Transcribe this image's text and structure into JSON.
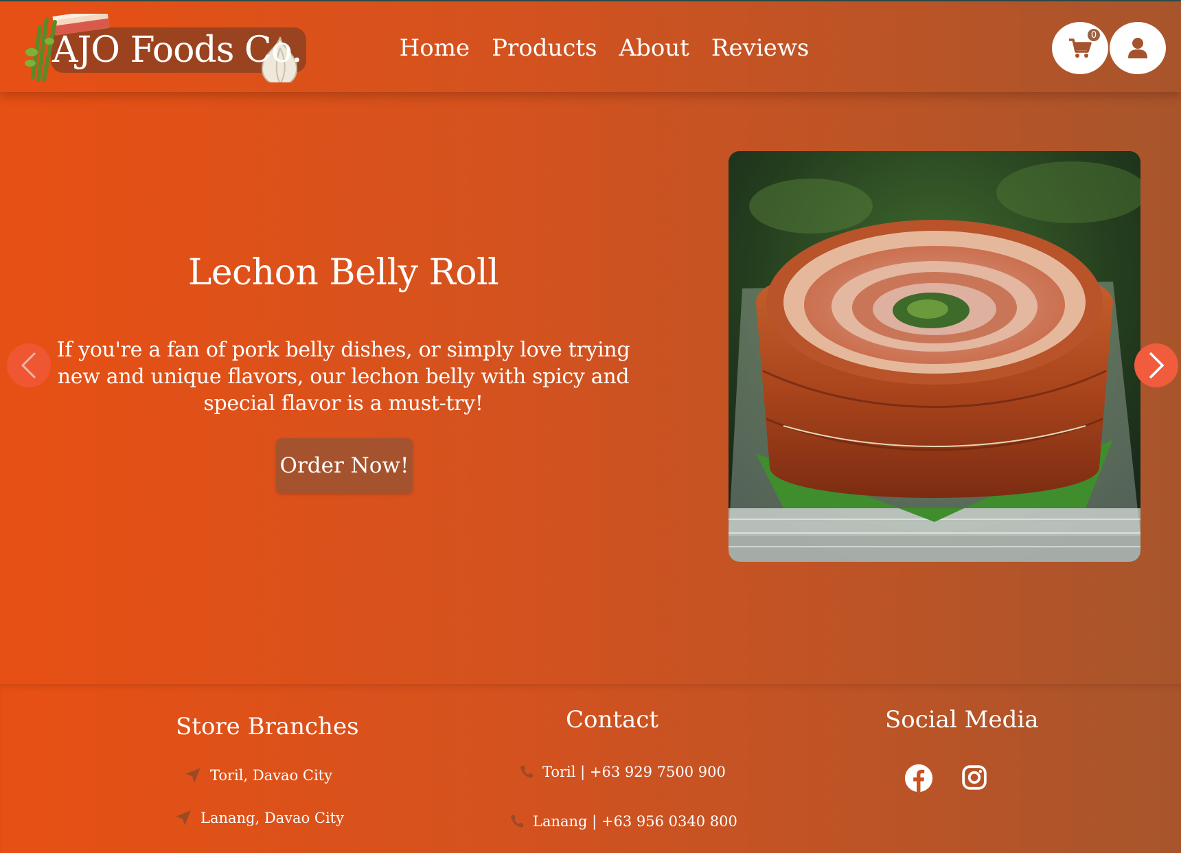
{
  "brand": {
    "name": "AJO Foods Co."
  },
  "nav": {
    "links": [
      "Home",
      "Products",
      "About",
      "Reviews"
    ]
  },
  "header": {
    "cart_count": "0"
  },
  "hero": {
    "title": "Lechon Belly Roll",
    "description": "If you're a fan of pork belly dishes, or simply love trying new and unique flavors, our lechon belly with spicy and special flavor is a must-try!",
    "cta_label": "Order Now!"
  },
  "footer": {
    "branches": {
      "title": "Store Branches",
      "items": [
        "Toril, Davao City",
        "Lanang, Davao City"
      ]
    },
    "contact": {
      "title": "Contact",
      "items": [
        "Toril | +63 929 7500 900",
        "Lanang | +63 956 0340 800"
      ]
    },
    "social": {
      "title": "Social Media",
      "icons": [
        "facebook-icon",
        "instagram-icon"
      ]
    }
  },
  "colors": {
    "bg_left": "#e75014",
    "bg_right": "#a8552c",
    "button": "#a5532e",
    "arrow": "#f05c3c"
  }
}
